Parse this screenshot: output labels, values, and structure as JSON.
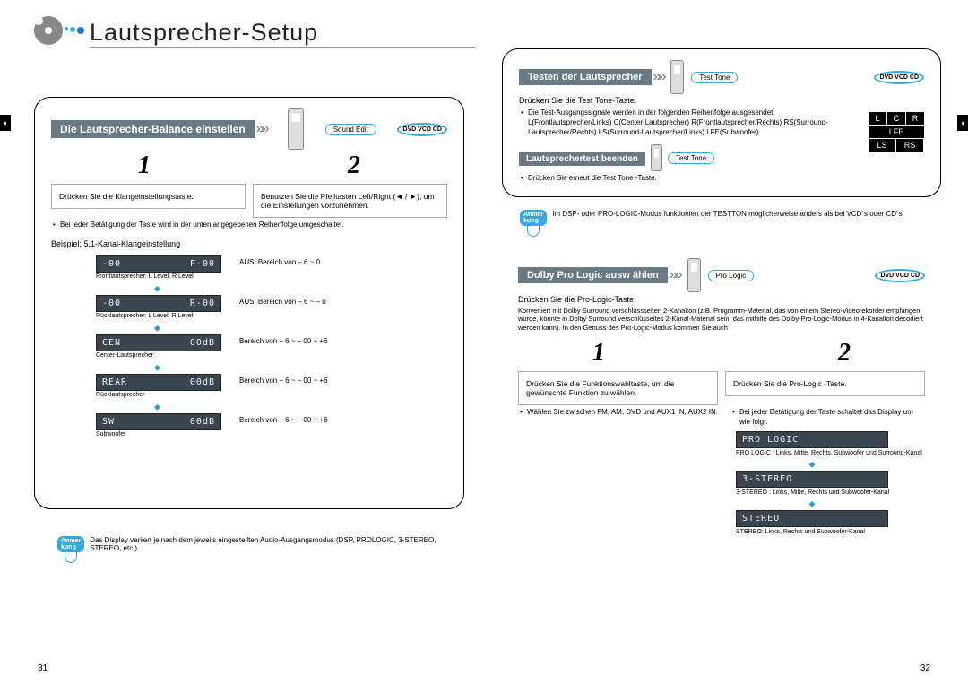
{
  "title": "Lautsprecher-Setup",
  "badges": {
    "dvd": "DVD VCD CD",
    "sound_edit": "Sound Edit",
    "test_tone": "Test Tone",
    "pro_logic": "Pro Logic"
  },
  "left": {
    "section1_title": "Die Lautsprecher-Balance einstellen",
    "step1_num": "1",
    "step2_num": "2",
    "step1_text": "Drücken Sie die Klangeinstellungstaste.",
    "step2_text": "Benutzen Sie die Pfeiltasten Left/Right  (◄ / ►), um die Einstellungen vorzunehmen.",
    "row_bullet": "Bei jeder Betätigung der Taste wird in der unten angegebenen Reihenfolge umgeschaltet.",
    "example_label": "Beispiel: 5.1-Kanal-Klangeinstellung",
    "displays": [
      {
        "text_left": "-00",
        "text_right": "F-00",
        "label": "Frontlautsprecher: L Level, R Level",
        "range": "AUS, Bereich von – 6 ~ 0"
      },
      {
        "text_left": "-00",
        "text_right": "R-00",
        "label": "Rücklautsprecher: L Level, R Level",
        "range": "AUS, Bereich von – 6 ~ – 0"
      },
      {
        "text_left": "CEN",
        "text_right": "00dB",
        "label": "Center-Lautsprecher",
        "range": "Bereich von – 6 ~ – 00 ~ +6"
      },
      {
        "text_left": "REAR",
        "text_right": "00dB",
        "label": "Rücklautsprecher",
        "range": "Bereich von – 6 ~ – 00 ~ +6"
      },
      {
        "text_left": "SW",
        "text_right": "00dB",
        "label": "Subwoofer",
        "range": "Bereich von – 6 ~ – 00 ~ +6"
      }
    ],
    "note_label": "Anmer\nkung",
    "note_text": "Das Display variiert je nach dem jeweils eingestellten Audio-Ausgangsmodus (DSP, PROLOGIC, 3-STEREO, STEREO, etc.).",
    "page_num": "31"
  },
  "right": {
    "test_title": "Testen der Lautsprecher",
    "test_instruction": "Drücken Sie die Test Tone-Taste.",
    "test_bullet": "Die Test-Ausgangssignale werden in der folgenden Reihenfolge ausgesendet: L(Frontlautsprecher/Links)  C(Center-Lautsprecher) R(Frontlautsprecher/Rechts)  RS(Surround-Lautsprecher/Rechts) LS(Surround-Lautsprecher/Links)  LFE(Subwoofer).",
    "end_test_title": "Lautsprechertest beenden",
    "end_test_text": "Drücken Sie erneut die Test Tone -Taste.",
    "note_label": "Anmer\nkung",
    "test_note": "Im DSP- oder PRO-LOGIC-Modus funktioniert der TESTTON möglicherweise anders als bei VCD´s oder CD´s.",
    "speakers": {
      "L": "L",
      "C": "C",
      "R": "R",
      "LFE": "LFE",
      "LS": "LS",
      "RS": "RS"
    },
    "dolby_title": "Dolby Pro Logic ausw   ählen",
    "dolby_instruction": "Drücken Sie die Pro-Logic-Taste.",
    "dolby_desc": "Konvertiert mit Dolby Surround verschlüssselten 2-Kanalton (z.B. Programm-Material, das von einem Stereo-Videorekorder empfangen wurde, könnte in Dolby Surround verschlüsseltes 2-Kanal-Material sein, das mithilfe des Dolby-Pro-Logic-Modus in 4-Kanalton decodiert werden kann). In den Genuss des Pro-Logic-Modus kommen Sie auch",
    "dolby_step1_text": "Drücken Sie die Funktionswahltaste, um die gewünschte Funktion zu wählen.",
    "dolby_step2_text": "Drücken Sie die Pro-Logic -Taste.",
    "dolby_step1_bullet": "Wählen Sie zwischen FM, AM, DVD und AUX1 IN, AUX2 IN.",
    "dolby_step2_bullet": "Bei jeder Betätigung der Taste schaltet das Display um wie folgt:",
    "modes": [
      {
        "display": "PRO  LOGIC",
        "label": "PRO LOGIC : Links, Mitte, Rechts, Subwoofer und Surround-Kanal"
      },
      {
        "display": "3-STEREO",
        "label": "3-STEREO : Links, Mitte, Rechts und Subwoofer-Kanal"
      },
      {
        "display": "STEREO",
        "label": "STEREO: Links, Rechts und Subwoofer-Kanal"
      }
    ],
    "page_num": "32"
  }
}
